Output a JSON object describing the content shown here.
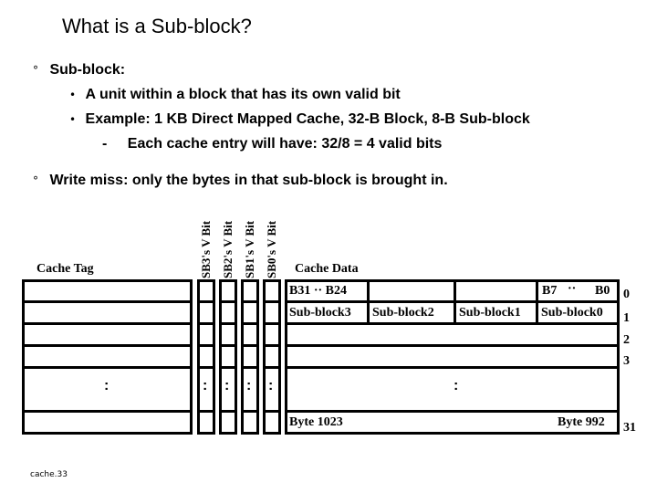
{
  "slide": {
    "title": "What is a Sub-block?",
    "bullets": [
      {
        "marker": "°",
        "text": "Sub-block:"
      },
      {
        "marker": "•",
        "text": "A unit within a block that has its own valid bit"
      },
      {
        "marker": "•",
        "text": "Example: 1 KB Direct Mapped Cache, 32-B Block, 8-B Sub-block"
      },
      {
        "marker": "-",
        "text": "Each cache entry will have: 32/8 = 4 valid bits"
      },
      {
        "marker": "°",
        "text": "Write miss: only the bytes in that sub-block is brought in."
      }
    ],
    "footer": "cache.33"
  },
  "diagram": {
    "cache_tag_label": "Cache Tag",
    "cache_data_label": "Cache Data",
    "valid_bit_labels": [
      "SB3's V Bit",
      "SB2's V Bit",
      "SB1's V Bit",
      "SB0's V Bit"
    ],
    "ellipsis": ":",
    "row0": {
      "left": "B31 ·· B24",
      "right_start": "B7",
      "right_dots": "··",
      "right_end": "B0"
    },
    "row1": [
      "Sub-block3",
      "Sub-block2",
      "Sub-block1",
      "Sub-block0"
    ],
    "last_row": {
      "left": "Byte 1023",
      "right": "Byte 992"
    },
    "row_indices": [
      "0",
      "1",
      "2",
      "3",
      "31"
    ]
  }
}
